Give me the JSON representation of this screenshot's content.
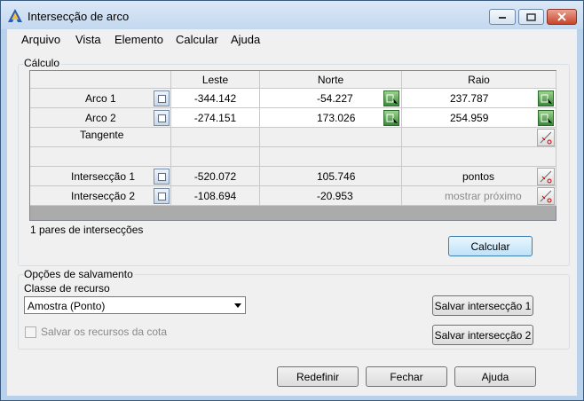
{
  "window": {
    "title": "Intersecção de arco"
  },
  "menu": [
    "Arquivo",
    "Vista",
    "Elemento",
    "Calcular",
    "Ajuda"
  ],
  "calculo": {
    "group_label": "Cálculo",
    "columns": [
      "Leste",
      "Norte",
      "Raio"
    ],
    "rows": [
      {
        "label": "Arco 1",
        "leste": "-344.142",
        "norte": "-54.227",
        "raio": "237.787"
      },
      {
        "label": "Arco 2",
        "leste": "-274.151",
        "norte": "173.026",
        "raio": "254.959"
      },
      {
        "label": "Tangente",
        "leste": "",
        "norte": "",
        "raio": ""
      },
      {
        "label": "",
        "leste": "",
        "norte": "",
        "raio": ""
      },
      {
        "label": "Intersecção 1",
        "leste": "-520.072",
        "norte": "105.746",
        "raio": "pontos"
      },
      {
        "label": "Intersecção 2",
        "leste": "-108.694",
        "norte": "-20.953",
        "raio": "mostrar próximo"
      }
    ],
    "status": "1 pares de intersecções",
    "calcular_button": "Calcular"
  },
  "salvamento": {
    "group_label": "Opções de salvamento",
    "classe_label": "Classe de recurso",
    "classe_value": "Amostra (Ponto)",
    "checkbox_label": "Salvar os recursos da cota",
    "checkbox_checked": false,
    "save1_button": "Salvar intersecção 1",
    "save2_button": "Salvar intersecção 2"
  },
  "footer": {
    "redefinir": "Redefinir",
    "fechar": "Fechar",
    "ajuda": "Ajuda"
  }
}
